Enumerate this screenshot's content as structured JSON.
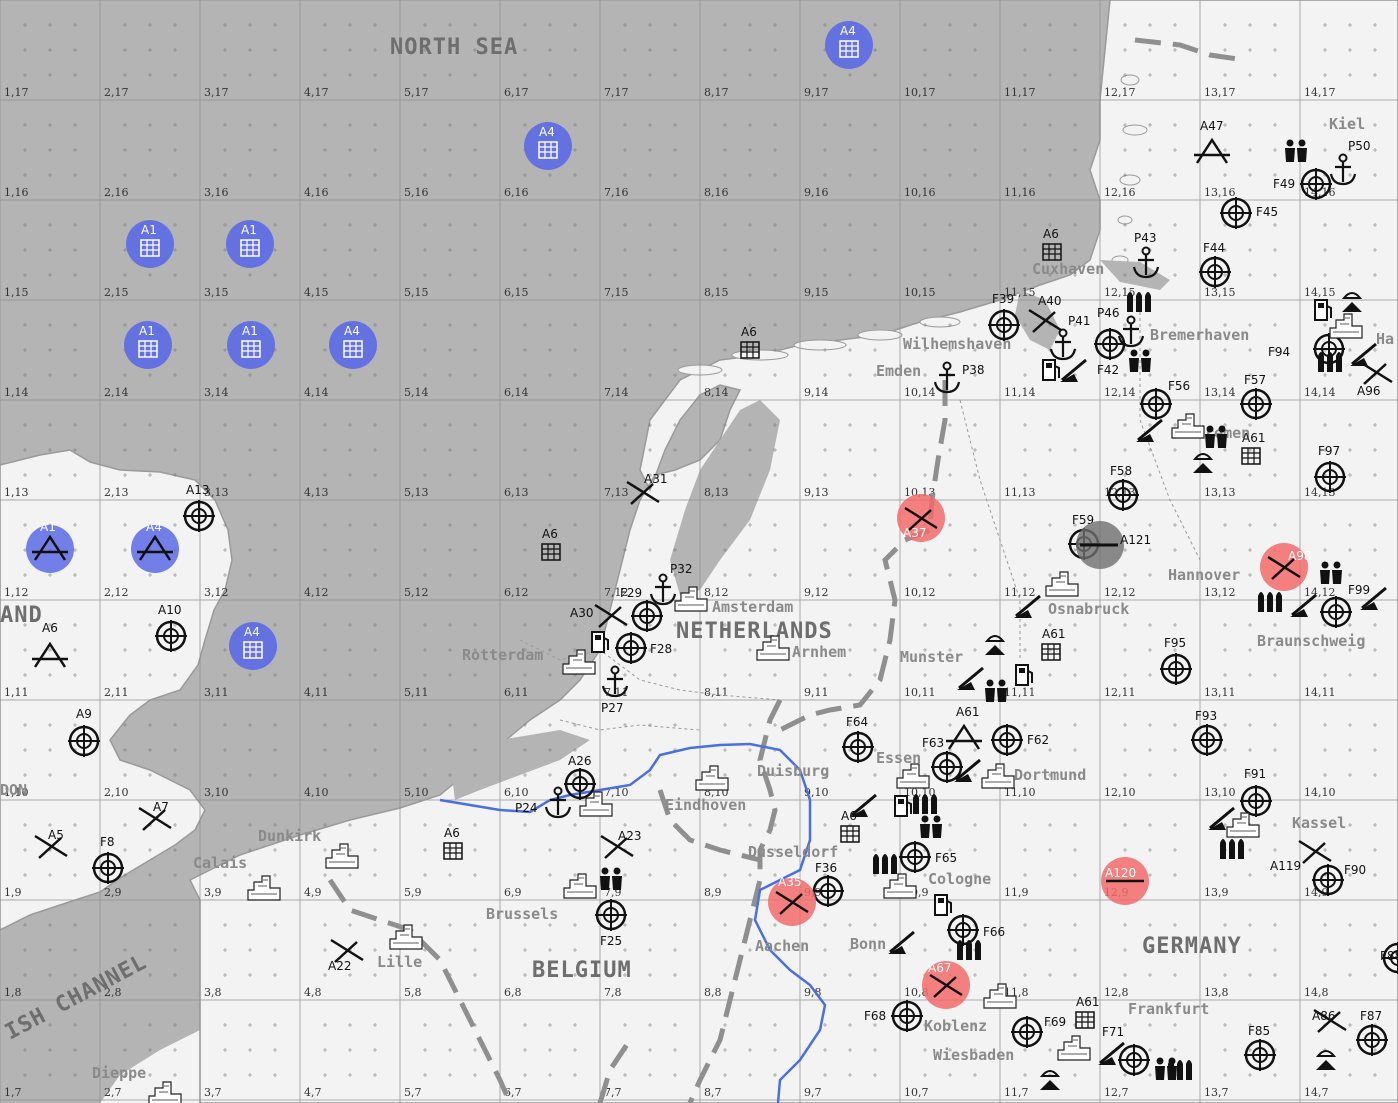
{
  "map": {
    "regions": [
      "NORTH SEA",
      "NETHERLANDS",
      "BELGIUM",
      "GERMANY",
      "AND",
      "ISH CHANNEL"
    ],
    "cities": [
      "Amsterdam",
      "Rotterdam",
      "Arnhem",
      "Eindhoven",
      "Brussels",
      "Dunkirk",
      "Calais",
      "Lille",
      "Dieppe",
      "Duisburg",
      "Essen",
      "Dusseldorf",
      "Aachen",
      "Cologne",
      "Bonn",
      "Koblenz",
      "Wiesbaden",
      "Frankfurt",
      "Dortmund",
      "Munster",
      "Osnabruck",
      "Emden",
      "Wilhemshaven",
      "Cuxhaven",
      "Bremerhaven",
      "Bremen",
      "Hannover",
      "Braunschweig",
      "Kassel",
      "Kiel",
      "Ha",
      "DON"
    ],
    "grid_rows": [
      "17",
      "16",
      "15",
      "14",
      "13",
      "12",
      "11",
      "10",
      "9",
      "8",
      "7"
    ],
    "grid_cols": [
      "1",
      "2",
      "3",
      "4",
      "5",
      "6",
      "7",
      "8",
      "9",
      "10",
      "11",
      "12",
      "13",
      "14"
    ],
    "units": {
      "targets": [
        "A13",
        "A10",
        "A9",
        "F8",
        "F29",
        "F28",
        "A26",
        "F25",
        "F64",
        "F63",
        "F62",
        "F36",
        "F65",
        "F66",
        "F68",
        "F69",
        "F71",
        "F39",
        "F42",
        "F56",
        "F57",
        "F58",
        "F59",
        "F44",
        "F45",
        "F49",
        "F94",
        "F95",
        "F93",
        "F91",
        "F90",
        "F97",
        "F99",
        "F85",
        "F87",
        "F88"
      ],
      "air_fields": [
        "A1",
        "A4",
        "A6",
        "A61",
        "A47"
      ],
      "ships": [
        "P32",
        "P27",
        "P24",
        "P38",
        "P41",
        "P46",
        "P43",
        "P50"
      ],
      "ground": [
        "A5",
        "A7",
        "A22",
        "A31",
        "A30",
        "A23",
        "A37",
        "A35",
        "A67",
        "A40",
        "A98",
        "A86",
        "A96",
        "A119",
        "A121",
        "A120"
      ],
      "installations": [
        "A4",
        "A1",
        "A6",
        "A61",
        "A6"
      ]
    },
    "colors": {
      "sea": "#b4b4b4",
      "land": "#f3f3f3",
      "grid": "#8c8c8c",
      "river": "#4a6fe0",
      "border": "#8f8f8f",
      "allied": "#5b6ae6",
      "enemy": "#f26a6a",
      "neutral": "#6e6e6e"
    }
  }
}
